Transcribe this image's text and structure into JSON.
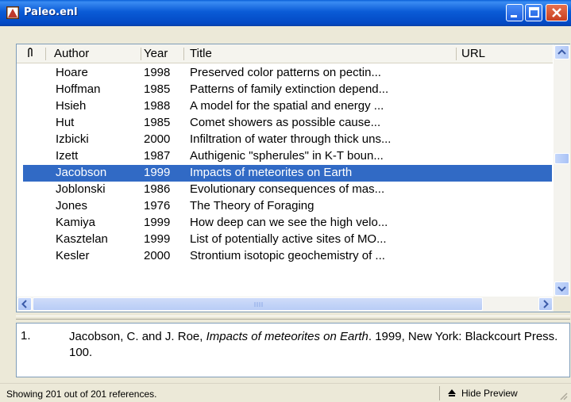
{
  "window": {
    "title": "Paleo.enl"
  },
  "columns": {
    "attachment": "0",
    "author": "Author",
    "year": "Year",
    "title": "Title",
    "url": "URL"
  },
  "references": [
    {
      "author": "Hoare",
      "year": "1998",
      "title": "Preserved color patterns on pectin..."
    },
    {
      "author": "Hoffman",
      "year": "1985",
      "title": "Patterns of family extinction depend..."
    },
    {
      "author": "Hsieh",
      "year": "1988",
      "title": "A model for the spatial and energy ..."
    },
    {
      "author": "Hut",
      "year": "1985",
      "title": "Comet showers as possible cause..."
    },
    {
      "author": "Izbicki",
      "year": "2000",
      "title": "Infiltration of water through thick uns..."
    },
    {
      "author": "Izett",
      "year": "1987",
      "title": "Authigenic \"spherules\" in K-T boun..."
    },
    {
      "author": "Jacobson",
      "year": "1999",
      "title": "Impacts of meteorites on Earth",
      "selected": true
    },
    {
      "author": "Joblonski",
      "year": "1986",
      "title": "Evolutionary consequences of mas..."
    },
    {
      "author": "Jones",
      "year": "1976",
      "title": "The Theory of Foraging"
    },
    {
      "author": "Kamiya",
      "year": "1999",
      "title": "How deep can we see the high velo..."
    },
    {
      "author": "Kasztelan",
      "year": "1999",
      "title": "List of potentially active sites of MO..."
    },
    {
      "author": "Kesler",
      "year": "2000",
      "title": "Strontium isotopic geochemistry of ..."
    }
  ],
  "preview": {
    "number": "1.",
    "citation_pre": "Jacobson, C. and J. Roe, ",
    "citation_title": "Impacts of meteorites on Earth",
    "citation_post": ". 1999, New York: Blackcourt Press. 100."
  },
  "statusbar": {
    "status_text": "Showing 201 out of 201 references.",
    "hide_preview_label": "Hide Preview"
  },
  "colors": {
    "selection": "#316ac5",
    "titlebar": "#0a5bd6",
    "close_button": "#c84020"
  }
}
